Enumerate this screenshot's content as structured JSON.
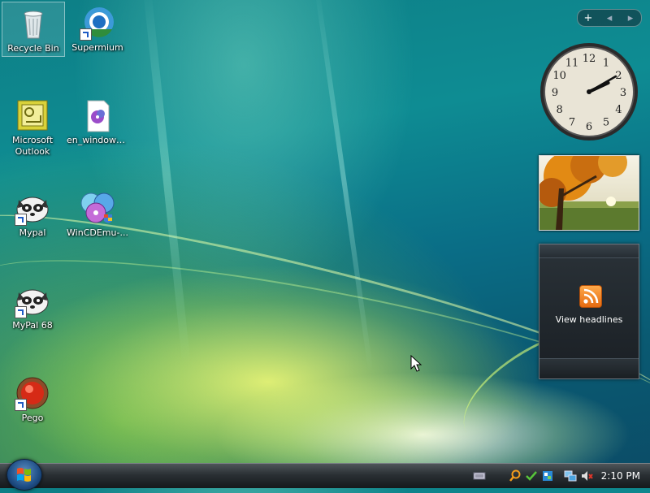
{
  "desktop": {
    "icons": [
      {
        "label": "Recycle Bin"
      },
      {
        "label": "Supermium"
      },
      {
        "label": "Microsoft Outlook"
      },
      {
        "label": "en_windows..."
      },
      {
        "label": "Mypal"
      },
      {
        "label": "WinCDEmu-..."
      },
      {
        "label": "MyPal 68"
      },
      {
        "label": "Pego"
      }
    ]
  },
  "sidebar": {
    "controls": {
      "add": "+",
      "prev": "◂",
      "next": "▸"
    },
    "clock": {
      "hour": 2,
      "minute": 10
    },
    "feed": {
      "label": "View headlines"
    }
  },
  "taskbar": {
    "time": "2:10 PM"
  },
  "colors": {
    "accent": "#0e8c93",
    "rss": "#f0851d"
  }
}
